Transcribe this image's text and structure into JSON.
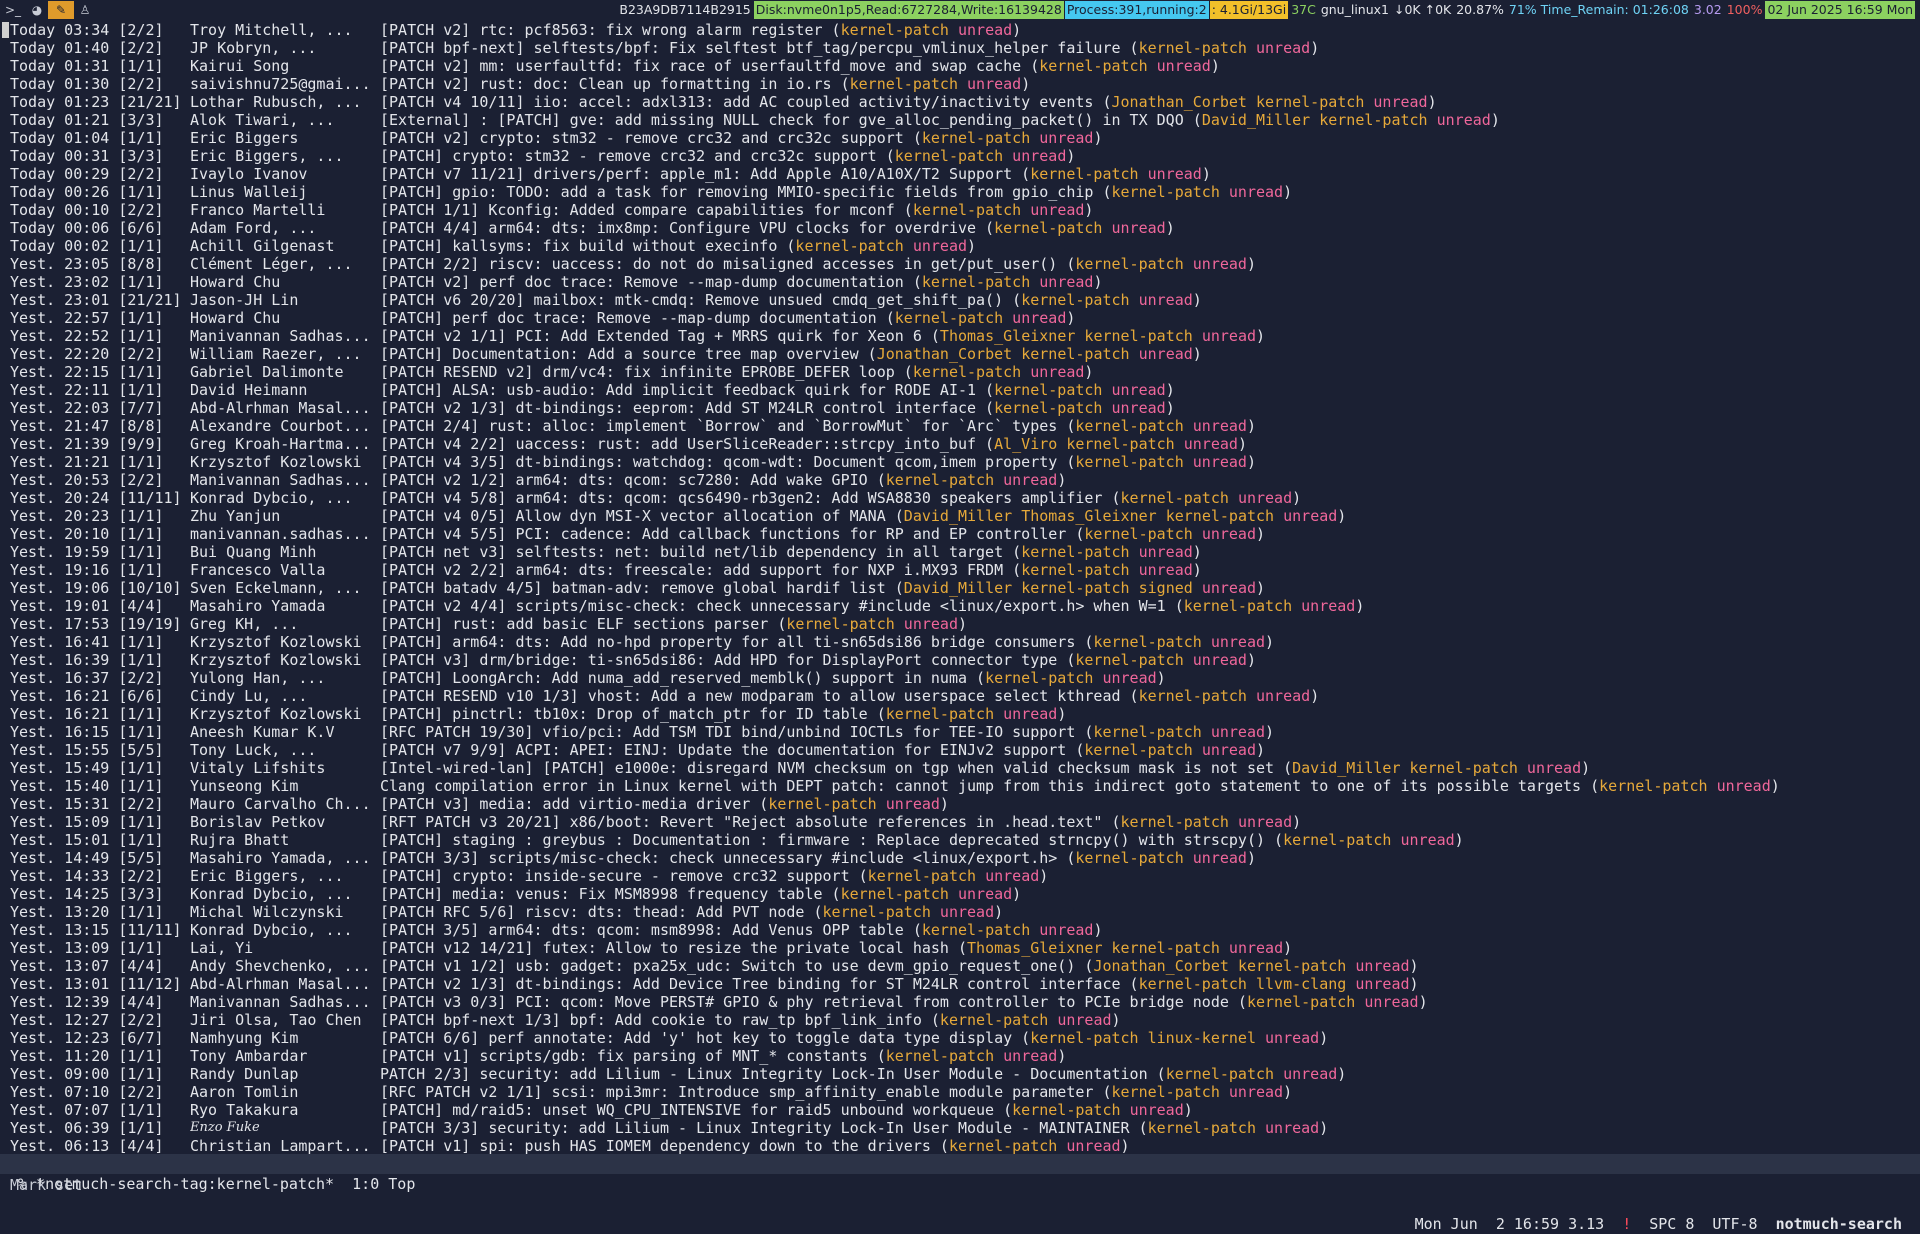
{
  "topbar": {
    "workspaces": [
      {
        "label": ">_",
        "icon": "terminal-icon",
        "active": false
      },
      {
        "label": "◕",
        "icon": "firefox-icon",
        "active": false
      },
      {
        "label": "✎",
        "icon": "editor-icon",
        "active": true
      },
      {
        "label": "♙",
        "icon": "app-icon",
        "active": false
      }
    ],
    "status": [
      {
        "label": "B23A9DB7114B2915",
        "icon": "key-icon",
        "cls": ""
      },
      {
        "label": "Disk:nvme0n1p5,Read:6727284,Write:16139428",
        "icon": "disk-icon",
        "cls": "bg-green"
      },
      {
        "label": "Process:391,running:2",
        "icon": "process-icon",
        "cls": "bg-cyan"
      },
      {
        "label": ": 4.1Gi/13Gi",
        "icon": "memory-icon",
        "cls": "bg-yellow"
      },
      {
        "label": "37C",
        "icon": "temperature-icon",
        "cls": "fg-green"
      },
      {
        "label": "gnu_linux1",
        "icon": "wifi-icon",
        "cls": ""
      },
      {
        "label": "↓0K ↑0K",
        "icon": "network-icon",
        "cls": ""
      },
      {
        "label": "20.87%",
        "icon": "cpu-icon",
        "cls": ""
      },
      {
        "label": "71% Time_Remain: 01:26:08",
        "icon": "battery-icon",
        "cls": "hl-cyan"
      },
      {
        "label": "3.02",
        "icon": "load-icon",
        "cls": "fg-purple"
      },
      {
        "label": "100%",
        "icon": "volume-icon",
        "cls": "fg-red"
      },
      {
        "label": "02 Jun 2025 16:59 Mon",
        "icon": "calendar-icon",
        "cls": "bg-green"
      },
      {
        "label": "",
        "icon": "tray-icon",
        "cls": ""
      }
    ]
  },
  "messages": [
    {
      "date": "Today 03:34",
      "count": "[2/2]",
      "author": "Troy Mitchell, ...",
      "subject": "[PATCH v2] rtc: pcf8563: fix wrong alarm register",
      "tags": [
        "kernel-patch",
        "unread"
      ]
    },
    {
      "date": "Today 01:40",
      "count": "[2/2]",
      "author": "JP Kobryn, ...",
      "subject": "[PATCH bpf-next] selftests/bpf: Fix selftest btf_tag/percpu_vmlinux_helper failure",
      "tags": [
        "kernel-patch",
        "unread"
      ]
    },
    {
      "date": "Today 01:31",
      "count": "[1/1]",
      "author": "Kairui Song",
      "subject": "[PATCH v2] mm: userfaultfd: fix race of userfaultfd_move and swap cache",
      "tags": [
        "kernel-patch",
        "unread"
      ]
    },
    {
      "date": "Today 01:30",
      "count": "[2/2]",
      "author": "saivishnu725@gmai...",
      "subject": "[PATCH v2] rust: doc: Clean up formatting in io.rs",
      "tags": [
        "kernel-patch",
        "unread"
      ]
    },
    {
      "date": "Today 01:23",
      "count": "[21/21]",
      "author": "Lothar Rubusch, ...",
      "subject": "[PATCH v4 10/11] iio: accel: adxl313: add AC coupled activity/inactivity events",
      "tags": [
        "Jonathan_Corbet",
        "kernel-patch",
        "unread"
      ]
    },
    {
      "date": "Today 01:21",
      "count": "[3/3]",
      "author": "Alok Tiwari, ...",
      "subject": "[External] : [PATCH] gve: add missing NULL check for gve_alloc_pending_packet() in TX DQO",
      "tags": [
        "David_Miller",
        "kernel-patch",
        "unread"
      ]
    },
    {
      "date": "Today 01:04",
      "count": "[1/1]",
      "author": "Eric Biggers",
      "subject": "[PATCH v2] crypto: stm32 - remove crc32 and crc32c support",
      "tags": [
        "kernel-patch",
        "unread"
      ]
    },
    {
      "date": "Today 00:31",
      "count": "[3/3]",
      "author": "Eric Biggers, ...",
      "subject": "[PATCH] crypto: stm32 - remove crc32 and crc32c support",
      "tags": [
        "kernel-patch",
        "unread"
      ]
    },
    {
      "date": "Today 00:29",
      "count": "[2/2]",
      "author": "Ivaylo Ivanov",
      "subject": "[PATCH v7 11/21] drivers/perf: apple_m1: Add Apple A10/A10X/T2 Support",
      "tags": [
        "kernel-patch",
        "unread"
      ]
    },
    {
      "date": "Today 00:26",
      "count": "[1/1]",
      "author": "Linus Walleij",
      "subject": "[PATCH] gpio: TODO: add a task for removing MMIO-specific fields from gpio_chip",
      "tags": [
        "kernel-patch",
        "unread"
      ]
    },
    {
      "date": "Today 00:10",
      "count": "[2/2]",
      "author": "Franco Martelli",
      "subject": "[PATCH 1/1] Kconfig: Added compare capabilities for mconf",
      "tags": [
        "kernel-patch",
        "unread"
      ]
    },
    {
      "date": "Today 00:06",
      "count": "[6/6]",
      "author": "Adam Ford, ...",
      "subject": "[PATCH 4/4] arm64: dts: imx8mp: Configure VPU clocks for overdrive",
      "tags": [
        "kernel-patch",
        "unread"
      ]
    },
    {
      "date": "Today 00:02",
      "count": "[1/1]",
      "author": "Achill Gilgenast",
      "subject": "[PATCH] kallsyms: fix build without execinfo",
      "tags": [
        "kernel-patch",
        "unread"
      ]
    },
    {
      "date": "Yest. 23:05",
      "count": "[8/8]",
      "author": "Clément Léger, ...",
      "subject": "[PATCH 2/2] riscv: uaccess: do not do misaligned accesses in get/put_user()",
      "tags": [
        "kernel-patch",
        "unread"
      ]
    },
    {
      "date": "Yest. 23:02",
      "count": "[1/1]",
      "author": "Howard Chu",
      "subject": "[PATCH v2] perf doc trace: Remove --map-dump documentation",
      "tags": [
        "kernel-patch",
        "unread"
      ]
    },
    {
      "date": "Yest. 23:01",
      "count": "[21/21]",
      "author": "Jason-JH Lin",
      "subject": "[PATCH v6 20/20] mailbox: mtk-cmdq: Remove unsued cmdq_get_shift_pa()",
      "tags": [
        "kernel-patch",
        "unread"
      ]
    },
    {
      "date": "Yest. 22:57",
      "count": "[1/1]",
      "author": "Howard Chu",
      "subject": "[PATCH] perf doc trace: Remove --map-dump documentation",
      "tags": [
        "kernel-patch",
        "unread"
      ]
    },
    {
      "date": "Yest. 22:52",
      "count": "[1/1]",
      "author": "Manivannan Sadhas...",
      "subject": "[PATCH v2 1/1] PCI: Add Extended Tag + MRRS quirk for Xeon 6",
      "tags": [
        "Thomas_Gleixner",
        "kernel-patch",
        "unread"
      ]
    },
    {
      "date": "Yest. 22:20",
      "count": "[2/2]",
      "author": "William Raezer, ...",
      "subject": "[PATCH] Documentation: Add a source tree map overview",
      "tags": [
        "Jonathan_Corbet",
        "kernel-patch",
        "unread"
      ]
    },
    {
      "date": "Yest. 22:15",
      "count": "[1/1]",
      "author": "Gabriel Dalimonte",
      "subject": "[PATCH RESEND v2] drm/vc4: fix infinite EPROBE_DEFER loop",
      "tags": [
        "kernel-patch",
        "unread"
      ]
    },
    {
      "date": "Yest. 22:11",
      "count": "[1/1]",
      "author": "David Heimann",
      "subject": "[PATCH] ALSA: usb-audio: Add implicit feedback quirk for RODE AI-1",
      "tags": [
        "kernel-patch",
        "unread"
      ]
    },
    {
      "date": "Yest. 22:03",
      "count": "[7/7]",
      "author": "Abd-Alrhman Masal...",
      "subject": "[PATCH v2 1/3] dt-bindings: eeprom: Add ST M24LR control interface",
      "tags": [
        "kernel-patch",
        "unread"
      ]
    },
    {
      "date": "Yest. 21:47",
      "count": "[8/8]",
      "author": "Alexandre Courbot...",
      "subject": "[PATCH 2/4] rust: alloc: implement `Borrow` and `BorrowMut` for `Arc` types",
      "tags": [
        "kernel-patch",
        "unread"
      ]
    },
    {
      "date": "Yest. 21:39",
      "count": "[9/9]",
      "author": "Greg Kroah-Hartma...",
      "subject": "[PATCH v4 2/2] uaccess: rust: add UserSliceReader::strcpy_into_buf",
      "tags": [
        "Al_Viro",
        "kernel-patch",
        "unread"
      ]
    },
    {
      "date": "Yest. 21:21",
      "count": "[1/1]",
      "author": "Krzysztof Kozlowski",
      "subject": "[PATCH v4 3/5] dt-bindings: watchdog: qcom-wdt: Document qcom,imem property",
      "tags": [
        "kernel-patch",
        "unread"
      ]
    },
    {
      "date": "Yest. 20:53",
      "count": "[2/2]",
      "author": "Manivannan Sadhas...",
      "subject": "[PATCH v2 1/2] arm64: dts: qcom: sc7280: Add wake GPIO",
      "tags": [
        "kernel-patch",
        "unread"
      ]
    },
    {
      "date": "Yest. 20:24",
      "count": "[11/11]",
      "author": "Konrad Dybcio, ...",
      "subject": "[PATCH v4 5/8] arm64: dts: qcom: qcs6490-rb3gen2: Add WSA8830 speakers amplifier",
      "tags": [
        "kernel-patch",
        "unread"
      ]
    },
    {
      "date": "Yest. 20:23",
      "count": "[1/1]",
      "author": "Zhu Yanjun",
      "subject": "[PATCH v4 0/5] Allow dyn MSI-X vector allocation of MANA",
      "tags": [
        "David_Miller",
        "Thomas_Gleixner",
        "kernel-patch",
        "unread"
      ]
    },
    {
      "date": "Yest. 20:10",
      "count": "[1/1]",
      "author": "manivannan.sadhas...",
      "subject": "[PATCH v4 5/5] PCI: cadence: Add callback functions for RP and EP controller",
      "tags": [
        "kernel-patch",
        "unread"
      ]
    },
    {
      "date": "Yest. 19:59",
      "count": "[1/1]",
      "author": "Bui Quang Minh",
      "subject": "[PATCH net v3] selftests: net: build net/lib dependency in all target",
      "tags": [
        "kernel-patch",
        "unread"
      ]
    },
    {
      "date": "Yest. 19:16",
      "count": "[1/1]",
      "author": "Francesco Valla",
      "subject": "[PATCH v2 2/2] arm64: dts: freescale: add support for NXP i.MX93 FRDM",
      "tags": [
        "kernel-patch",
        "unread"
      ]
    },
    {
      "date": "Yest. 19:06",
      "count": "[10/10]",
      "author": "Sven Eckelmann, ...",
      "subject": "[PATCH batadv 4/5] batman-adv: remove global hardif list",
      "tags": [
        "David_Miller",
        "kernel-patch",
        "signed",
        "unread"
      ]
    },
    {
      "date": "Yest. 19:01",
      "count": "[4/4]",
      "author": "Masahiro Yamada",
      "subject": "[PATCH v2 4/4] scripts/misc-check: check unnecessary #include <linux/export.h> when W=1",
      "tags": [
        "kernel-patch",
        "unread"
      ]
    },
    {
      "date": "Yest. 17:53",
      "count": "[19/19]",
      "author": "Greg KH, ...",
      "subject": "[PATCH] rust: add basic ELF sections parser",
      "tags": [
        "kernel-patch",
        "unread"
      ]
    },
    {
      "date": "Yest. 16:41",
      "count": "[1/1]",
      "author": "Krzysztof Kozlowski",
      "subject": "[PATCH] arm64: dts: Add no-hpd property for all ti-sn65dsi86 bridge consumers",
      "tags": [
        "kernel-patch",
        "unread"
      ]
    },
    {
      "date": "Yest. 16:39",
      "count": "[1/1]",
      "author": "Krzysztof Kozlowski",
      "subject": "[PATCH v3] drm/bridge: ti-sn65dsi86: Add HPD for DisplayPort connector type",
      "tags": [
        "kernel-patch",
        "unread"
      ]
    },
    {
      "date": "Yest. 16:37",
      "count": "[2/2]",
      "author": "Yulong Han, ...",
      "subject": "[PATCH] LoongArch: Add numa_add_reserved_memblk() support in numa",
      "tags": [
        "kernel-patch",
        "unread"
      ]
    },
    {
      "date": "Yest. 16:21",
      "count": "[6/6]",
      "author": "Cindy Lu, ...",
      "subject": "[PATCH RESEND v10 1/3] vhost: Add a new modparam to allow userspace select kthread",
      "tags": [
        "kernel-patch",
        "unread"
      ]
    },
    {
      "date": "Yest. 16:21",
      "count": "[1/1]",
      "author": "Krzysztof Kozlowski",
      "subject": "[PATCH] pinctrl: tb10x: Drop of_match_ptr for ID table",
      "tags": [
        "kernel-patch",
        "unread"
      ]
    },
    {
      "date": "Yest. 16:15",
      "count": "[1/1]",
      "author": "Aneesh Kumar K.V",
      "subject": "[RFC PATCH 19/30] vfio/pci: Add TSM TDI bind/unbind IOCTLs for TEE-IO support",
      "tags": [
        "kernel-patch",
        "unread"
      ]
    },
    {
      "date": "Yest. 15:55",
      "count": "[5/5]",
      "author": "Tony Luck, ...",
      "subject": "[PATCH v7 9/9] ACPI: APEI: EINJ: Update the documentation for EINJv2 support",
      "tags": [
        "kernel-patch",
        "unread"
      ]
    },
    {
      "date": "Yest. 15:49",
      "count": "[1/1]",
      "author": "Vitaly Lifshits",
      "subject": "[Intel-wired-lan] [PATCH] e1000e: disregard NVM checksum on tgp when valid checksum mask is not set",
      "tags": [
        "David_Miller",
        "kernel-patch",
        "unread"
      ]
    },
    {
      "date": "Yest. 15:40",
      "count": "[1/1]",
      "author": "Yunseong Kim",
      "subject": "Clang compilation error in Linux kernel with DEPT patch: cannot jump from this indirect goto statement to one of its possible targets",
      "tags": [
        "kernel-patch",
        "unread"
      ]
    },
    {
      "date": "Yest. 15:31",
      "count": "[2/2]",
      "author": "Mauro Carvalho Ch...",
      "subject": "[PATCH v3] media: add virtio-media driver",
      "tags": [
        "kernel-patch",
        "unread"
      ]
    },
    {
      "date": "Yest. 15:09",
      "count": "[1/1]",
      "author": "Borislav Petkov",
      "subject": "[RFT PATCH v3 20/21] x86/boot: Revert \"Reject absolute references in .head.text\"",
      "tags": [
        "kernel-patch",
        "unread"
      ]
    },
    {
      "date": "Yest. 15:01",
      "count": "[1/1]",
      "author": "Rujra Bhatt",
      "subject": "[PATCH] staging : greybus : Documentation : firmware : Replace deprecated strncpy() with strscpy()",
      "tags": [
        "kernel-patch",
        "unread"
      ]
    },
    {
      "date": "Yest. 14:49",
      "count": "[5/5]",
      "author": "Masahiro Yamada, ...",
      "subject": "[PATCH 3/3] scripts/misc-check: check unnecessary #include <linux/export.h>",
      "tags": [
        "kernel-patch",
        "unread"
      ]
    },
    {
      "date": "Yest. 14:33",
      "count": "[2/2]",
      "author": "Eric Biggers, ...",
      "subject": "[PATCH] crypto: inside-secure - remove crc32 support",
      "tags": [
        "kernel-patch",
        "unread"
      ]
    },
    {
      "date": "Yest. 14:25",
      "count": "[3/3]",
      "author": "Konrad Dybcio, ...",
      "subject": "[PATCH] media: venus: Fix MSM8998 frequency table",
      "tags": [
        "kernel-patch",
        "unread"
      ]
    },
    {
      "date": "Yest. 13:20",
      "count": "[1/1]",
      "author": "Michal Wilczynski",
      "subject": "[PATCH RFC 5/6] riscv: dts: thead: Add PVT node",
      "tags": [
        "kernel-patch",
        "unread"
      ]
    },
    {
      "date": "Yest. 13:15",
      "count": "[11/11]",
      "author": "Konrad Dybcio, ...",
      "subject": "[PATCH 3/5] arm64: dts: qcom: msm8998: Add Venus OPP table",
      "tags": [
        "kernel-patch",
        "unread"
      ]
    },
    {
      "date": "Yest. 13:09",
      "count": "[1/1]",
      "author": "Lai, Yi",
      "subject": "[PATCH v12 14/21] futex: Allow to resize the private local hash",
      "tags": [
        "Thomas_Gleixner",
        "kernel-patch",
        "unread"
      ]
    },
    {
      "date": "Yest. 13:07",
      "count": "[4/4]",
      "author": "Andy Shevchenko, ...",
      "subject": "[PATCH v1 1/2] usb: gadget: pxa25x_udc: Switch to use devm_gpio_request_one()",
      "tags": [
        "Jonathan_Corbet",
        "kernel-patch",
        "unread"
      ]
    },
    {
      "date": "Yest. 13:01",
      "count": "[11/12]",
      "author": "Abd-Alrhman Masal...",
      "subject": "[PATCH v2 1/3] dt-bindings: Add Device Tree binding for ST M24LR control interface",
      "tags": [
        "kernel-patch",
        "llvm-clang",
        "unread"
      ]
    },
    {
      "date": "Yest. 12:39",
      "count": "[4/4]",
      "author": "Manivannan Sadhas...",
      "subject": "[PATCH v3 0/3] PCI: qcom: Move PERST# GPIO & phy retrieval from controller to PCIe bridge node",
      "tags": [
        "kernel-patch",
        "unread"
      ]
    },
    {
      "date": "Yest. 12:27",
      "count": "[2/2]",
      "author": "Jiri Olsa, Tao Chen",
      "subject": "[PATCH bpf-next 1/3] bpf: Add cookie to raw_tp bpf_link_info",
      "tags": [
        "kernel-patch",
        "unread"
      ]
    },
    {
      "date": "Yest. 12:23",
      "count": "[6/7]",
      "author": "Namhyung Kim",
      "subject": "[PATCH 6/6] perf annotate: Add 'y' hot key to toggle data type display",
      "tags": [
        "kernel-patch",
        "linux-kernel",
        "unread"
      ]
    },
    {
      "date": "Yest. 11:20",
      "count": "[1/1]",
      "author": "Tony Ambardar",
      "subject": "[PATCH v1] scripts/gdb: fix parsing of MNT_* constants",
      "tags": [
        "kernel-patch",
        "unread"
      ]
    },
    {
      "date": "Yest. 09:00",
      "count": "[1/1]",
      "author": "Randy Dunlap",
      "subject": "PATCH 2/3] security: add Lilium - Linux Integrity Lock-In User Module - Documentation",
      "tags": [
        "kernel-patch",
        "unread"
      ]
    },
    {
      "date": "Yest. 07:10",
      "count": "[2/2]",
      "author": "Aaron Tomlin",
      "subject": "[RFC PATCH v2 1/1] scsi: mpi3mr: Introduce smp_affinity_enable module parameter",
      "tags": [
        "kernel-patch",
        "unread"
      ]
    },
    {
      "date": "Yest. 07:07",
      "count": "[1/1]",
      "author": "Ryo Takakura",
      "subject": "[PATCH] md/raid5: unset WQ_CPU_INTENSIVE for raid5 unbound workqueue",
      "tags": [
        "kernel-patch",
        "unread"
      ]
    },
    {
      "date": "Yest. 06:39",
      "count": "[1/1]",
      "author": "Enzo Fuke",
      "subject": "[PATCH 3/3] security: add Lilium - Linux Integrity Lock-In User Module - MAINTAINER",
      "tags": [
        "kernel-patch",
        "unread"
      ]
    },
    {
      "date": "Yest. 06:13",
      "count": "[4/4]",
      "author": "Christian Lampart...",
      "subject": "[PATCH v1] spi: push HAS_IOMEM dependency down to the drivers",
      "tags": [
        "kernel-patch",
        "unread"
      ]
    }
  ],
  "modeline": {
    "buffer": "% *notmuch-search-tag:kernel-patch*",
    "position": "1:0 Top",
    "datetime": "Mon Jun  2 16:59 3.13",
    "warn": "!",
    "indent": "SPC 8",
    "encoding": "UTF-8",
    "mode": "notmuch-search"
  },
  "echo": "Mark set",
  "colors": {
    "background": "#1b2033",
    "tag": "#e6a93a",
    "unread": "#f0679b",
    "modeline": "#2c3347"
  }
}
